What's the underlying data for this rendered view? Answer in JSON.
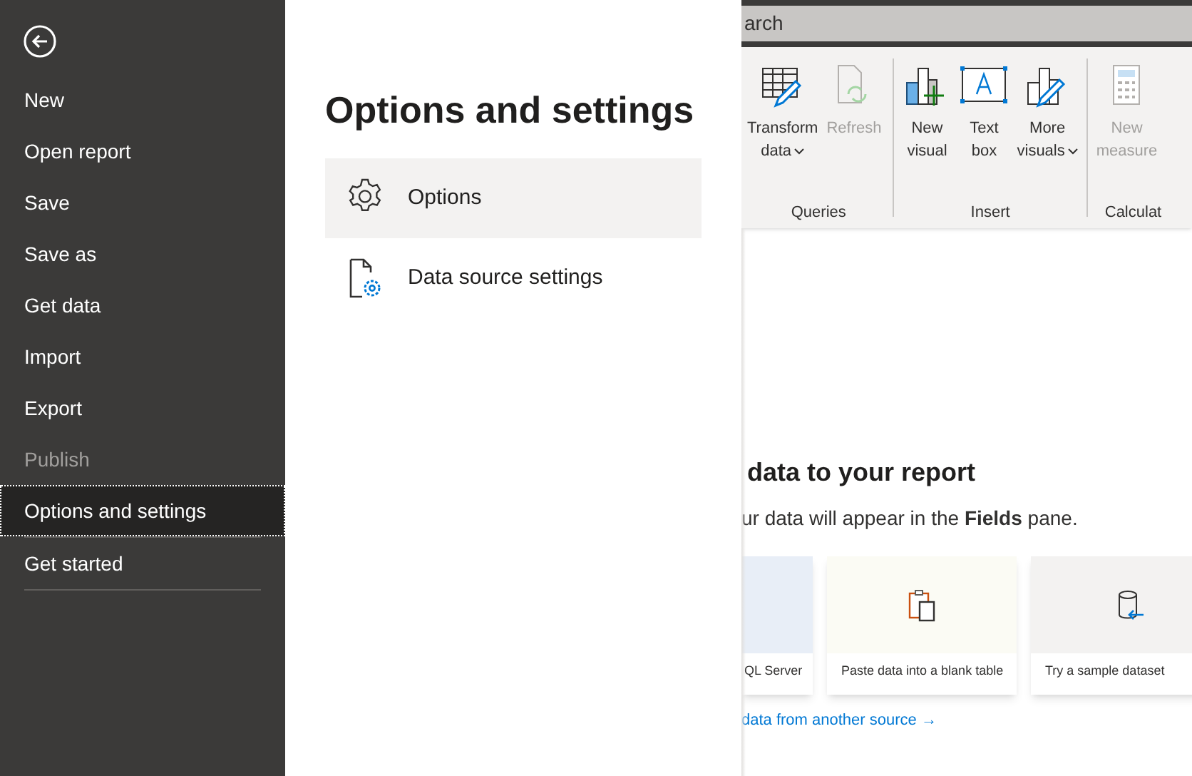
{
  "menu": [
    {
      "label": "New",
      "selected": false,
      "disabled": false
    },
    {
      "label": "Open report",
      "selected": false,
      "disabled": false
    },
    {
      "label": "Save",
      "selected": false,
      "disabled": false
    },
    {
      "label": "Save as",
      "selected": false,
      "disabled": false
    },
    {
      "label": "Get data",
      "selected": false,
      "disabled": false
    },
    {
      "label": "Import",
      "selected": false,
      "disabled": false
    },
    {
      "label": "Export",
      "selected": false,
      "disabled": false
    },
    {
      "label": "Publish",
      "selected": false,
      "disabled": true
    },
    {
      "label": "Options and settings",
      "selected": true,
      "disabled": false
    },
    {
      "label": "Get started",
      "selected": false,
      "disabled": false
    }
  ],
  "panel": {
    "title": "Options and settings",
    "items": [
      {
        "label": "Options",
        "kind": "gear",
        "selected": true
      },
      {
        "label": "Data source settings",
        "kind": "document-gear",
        "selected": false
      }
    ]
  },
  "search": {
    "placeholder": "arch"
  },
  "ribbon": [
    {
      "label": "Queries",
      "buttons": [
        {
          "lines": [
            "Transform",
            "data"
          ],
          "dropdown": true,
          "disabled": false,
          "kind": "table-pencil"
        },
        {
          "lines": [
            "Refresh"
          ],
          "dropdown": false,
          "disabled": true,
          "kind": "refresh"
        }
      ]
    },
    {
      "label": "Insert",
      "buttons": [
        {
          "lines": [
            "New",
            "visual"
          ],
          "dropdown": false,
          "disabled": false,
          "kind": "chart-plus"
        },
        {
          "lines": [
            "Text",
            "box"
          ],
          "dropdown": false,
          "disabled": false,
          "kind": "textbox"
        },
        {
          "lines": [
            "More",
            "visuals"
          ],
          "dropdown": true,
          "disabled": false,
          "kind": "chart-pencil"
        }
      ]
    },
    {
      "label": "Calculat",
      "buttons": [
        {
          "lines": [
            "New",
            "measure"
          ],
          "dropdown": false,
          "disabled": true,
          "kind": "calculator"
        }
      ]
    }
  ],
  "canvas": {
    "heading": "data to your report",
    "subtext": "ur data will appear in the **Fields** pane.",
    "cards": [
      {
        "label": "QL Server",
        "kind": "sql"
      },
      {
        "label": "Paste data into a blank table",
        "kind": "paste"
      },
      {
        "label": "Try a sample dataset",
        "kind": "sample"
      }
    ],
    "link": "data from another source →"
  }
}
